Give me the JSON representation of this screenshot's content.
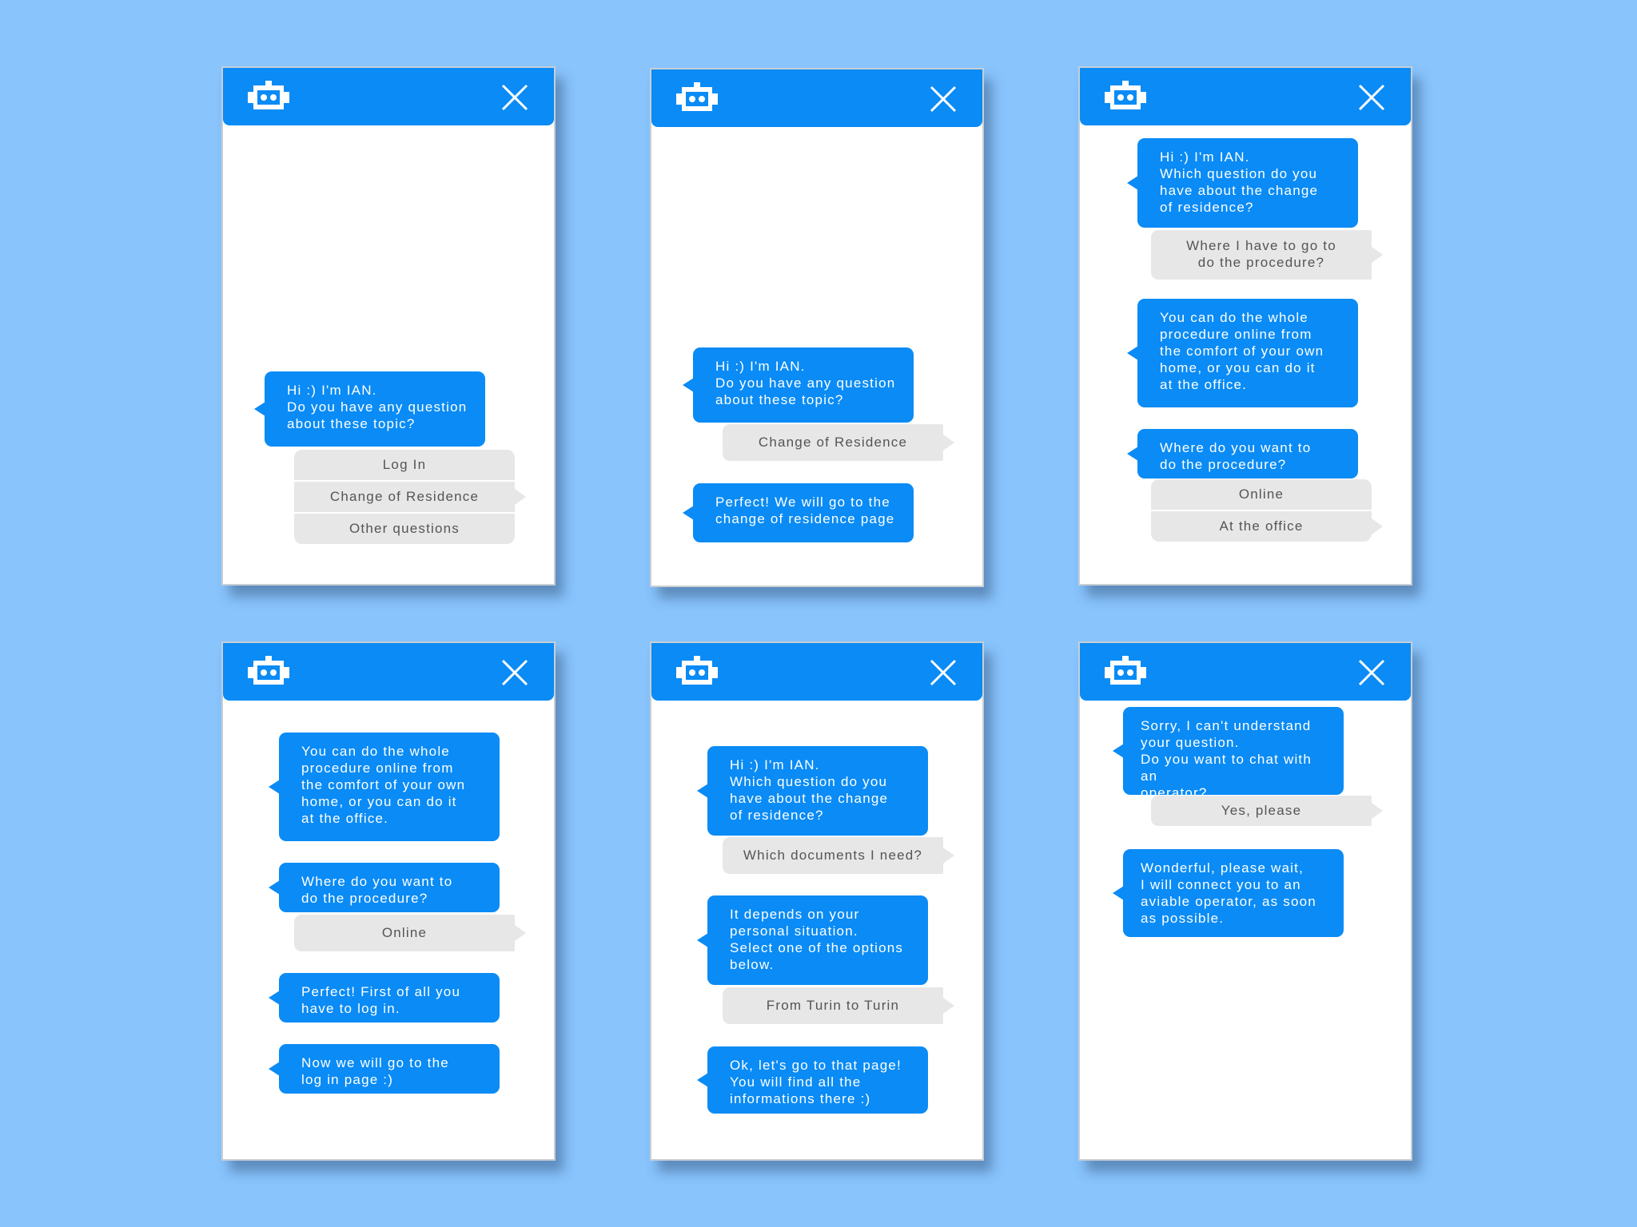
{
  "colors": {
    "background": "#89c4fd",
    "accent": "#0a8bf5",
    "user_bubble": "#e7e7e7",
    "user_text": "#555555"
  },
  "icons": {
    "header_left": "robot-icon",
    "header_right": "close-icon"
  },
  "screens": [
    {
      "messages": [
        {
          "from": "bot",
          "text": "Hi :) I'm IAN.\nDo you have any question\nabout these topic?"
        }
      ],
      "options": [
        "Log In",
        "Change of Residence",
        "Other questions"
      ]
    },
    {
      "messages": [
        {
          "from": "bot",
          "text": "Hi :) I'm IAN.\nDo you have any question\nabout these topic?"
        },
        {
          "from": "user",
          "text": "Change of Residence"
        },
        {
          "from": "bot",
          "text": "Perfect! We will go to the\nchange of residence page"
        }
      ]
    },
    {
      "messages": [
        {
          "from": "bot",
          "text": "Hi :) I'm IAN.\nWhich question do you\nhave about the change\nof residence?"
        },
        {
          "from": "user",
          "text": "Where I have to go to\ndo the procedure?"
        },
        {
          "from": "bot",
          "text": "You can do the whole\nprocedure online from\nthe comfort of your own\nhome, or you can do it\nat the office."
        },
        {
          "from": "bot",
          "text": "Where do you want to\ndo the procedure?"
        }
      ],
      "options": [
        "Online",
        "At the office"
      ]
    },
    {
      "messages": [
        {
          "from": "bot",
          "text": "You can do the whole\nprocedure online from\nthe comfort of your own\nhome, or you can do it\nat the office."
        },
        {
          "from": "bot",
          "text": "Where do you want to\ndo the procedure?"
        },
        {
          "from": "user",
          "text": "Online"
        },
        {
          "from": "bot",
          "text": "Perfect! First of all you\nhave to log in."
        },
        {
          "from": "bot",
          "text": "Now we will go to the\nlog in page :)"
        }
      ]
    },
    {
      "messages": [
        {
          "from": "bot",
          "text": "Hi :) I'm IAN.\nWhich question do you\nhave about the change\nof residence?"
        },
        {
          "from": "user",
          "text": "Which documents I need?"
        },
        {
          "from": "bot",
          "text": "It depends on your\npersonal situation.\nSelect one of the options\nbelow."
        },
        {
          "from": "user",
          "text": "From Turin to Turin"
        },
        {
          "from": "bot",
          "text": "Ok, let's go to that page!\nYou will find all the\ninformations there :)"
        }
      ]
    },
    {
      "messages": [
        {
          "from": "bot",
          "text": "Sorry, I can't understand\nyour question.\nDo you want to chat with an\noperator?"
        },
        {
          "from": "user",
          "text": "Yes, please"
        },
        {
          "from": "bot",
          "text": "Wonderful, please wait,\nI will connect you to an\naviable operator, as soon\nas possible."
        }
      ]
    }
  ]
}
